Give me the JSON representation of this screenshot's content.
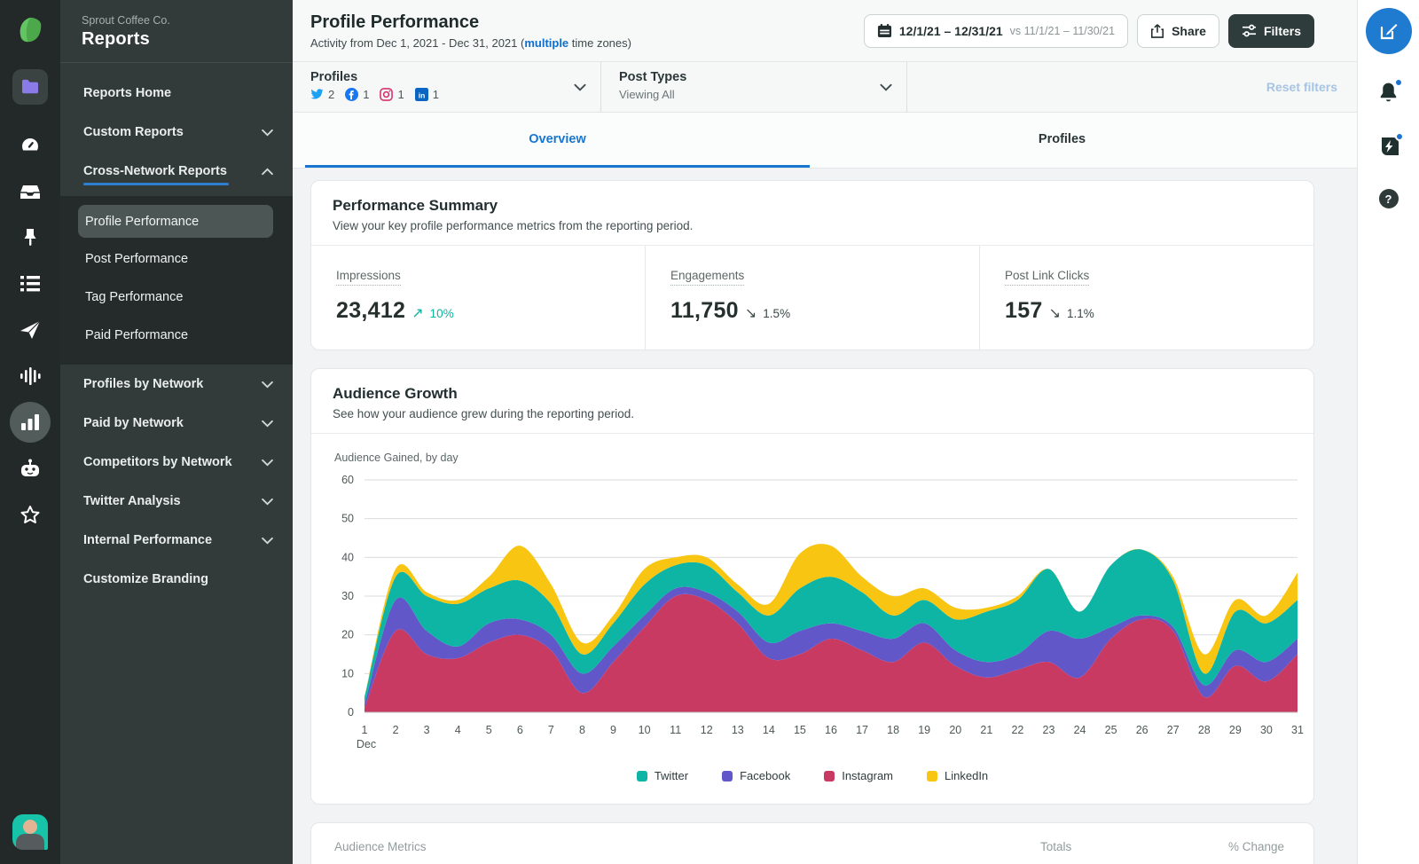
{
  "sidebar": {
    "company": "Sprout Coffee Co.",
    "title": "Reports",
    "items": [
      {
        "label": "Reports Home",
        "chevron": null,
        "active": false
      },
      {
        "label": "Custom Reports",
        "chevron": "down",
        "active": false
      },
      {
        "label": "Cross-Network Reports",
        "chevron": "up",
        "active": true,
        "children": [
          "Profile Performance",
          "Post Performance",
          "Tag Performance",
          "Paid Performance"
        ],
        "selected_child": "Profile Performance"
      },
      {
        "label": "Profiles by Network",
        "chevron": "down",
        "active": false
      },
      {
        "label": "Paid by Network",
        "chevron": "down",
        "active": false
      },
      {
        "label": "Competitors by Network",
        "chevron": "down",
        "active": false
      },
      {
        "label": "Twitter Analysis",
        "chevron": "down",
        "active": false
      },
      {
        "label": "Internal Performance",
        "chevron": "down",
        "active": false
      },
      {
        "label": "Customize Branding",
        "chevron": null,
        "active": false
      }
    ]
  },
  "header": {
    "title": "Profile Performance",
    "subtitle_prefix": "Activity from Dec 1, 2021 - Dec 31, 2021 (",
    "subtitle_link": "multiple",
    "subtitle_suffix": " time zones)",
    "date_range": "12/1/21 – 12/31/21",
    "date_compare": "vs 11/1/21 – 11/30/21",
    "share_label": "Share",
    "filters_label": "Filters"
  },
  "filter_bar": {
    "profiles_label": "Profiles",
    "profiles": [
      {
        "network": "twitter",
        "count": "2"
      },
      {
        "network": "facebook",
        "count": "1"
      },
      {
        "network": "instagram",
        "count": "1"
      },
      {
        "network": "linkedin",
        "count": "1"
      }
    ],
    "post_types_label": "Post Types",
    "post_types_value": "Viewing All",
    "reset_label": "Reset filters"
  },
  "tabs": [
    {
      "label": "Overview",
      "active": true
    },
    {
      "label": "Profiles",
      "active": false
    }
  ],
  "summary_card": {
    "title": "Performance Summary",
    "subtitle": "View your key profile performance metrics from the reporting period.",
    "up_glyph": "↗",
    "down_glyph": "↘",
    "metrics": [
      {
        "label": "Impressions",
        "value": "23,412",
        "trend": "up",
        "change": "10%"
      },
      {
        "label": "Engagements",
        "value": "11,750",
        "trend": "down",
        "change": "1.5%"
      },
      {
        "label": "Post Link Clicks",
        "value": "157",
        "trend": "down",
        "change": "1.1%"
      }
    ]
  },
  "growth_card": {
    "title": "Audience Growth",
    "subtitle": "See how your audience grew during the reporting period.",
    "chart_label": "Audience Gained, by day"
  },
  "chart_data": {
    "type": "area",
    "stacked": true,
    "title": "Audience Gained, by day",
    "x": [
      1,
      2,
      3,
      4,
      5,
      6,
      7,
      8,
      9,
      10,
      11,
      12,
      13,
      14,
      15,
      16,
      17,
      18,
      19,
      20,
      21,
      22,
      23,
      24,
      25,
      26,
      27,
      28,
      29,
      30,
      31
    ],
    "x_unit_label": "Dec",
    "ylim": [
      0,
      60
    ],
    "yticks": [
      0,
      10,
      20,
      30,
      40,
      50,
      60
    ],
    "grid": true,
    "legend_position": "bottom",
    "series": [
      {
        "name": "Instagram",
        "color": "#C93A63",
        "values": [
          1,
          21,
          15,
          14,
          18,
          20,
          16,
          5,
          13,
          22,
          30,
          29,
          23,
          14,
          15,
          19,
          16,
          13,
          18,
          12,
          9,
          11,
          13,
          9,
          19,
          24,
          21,
          4,
          12,
          8,
          15
        ]
      },
      {
        "name": "Facebook",
        "color": "#6257C8",
        "values": [
          1,
          8,
          6,
          3,
          5,
          4,
          4,
          5,
          4,
          3,
          2,
          2,
          3,
          4,
          6,
          4,
          5,
          6,
          5,
          4,
          4,
          4,
          8,
          10,
          3,
          1,
          1,
          3,
          4,
          5,
          4
        ]
      },
      {
        "name": "Twitter",
        "color": "#0EB5A5",
        "values": [
          2,
          6,
          9,
          11,
          9,
          10,
          8,
          5,
          6,
          8,
          6,
          7,
          5,
          7,
          11,
          12,
          10,
          6,
          6,
          8,
          13,
          14,
          16,
          7,
          16,
          17,
          12,
          3,
          10,
          10,
          10
        ]
      },
      {
        "name": "LinkedIn",
        "color": "#F9C513",
        "values": [
          0,
          2,
          1,
          1,
          3,
          9,
          5,
          3,
          2,
          4,
          2,
          2,
          2,
          3,
          9,
          8,
          4,
          5,
          3,
          3,
          1,
          1,
          0,
          0,
          0,
          0,
          1,
          5,
          3,
          2,
          7
        ]
      }
    ],
    "legend_order": [
      "Twitter",
      "Facebook",
      "Instagram",
      "LinkedIn"
    ]
  },
  "metrics_table": {
    "header": "Audience Metrics",
    "totals_label": "Totals",
    "change_label": "% Change"
  },
  "icons": {
    "trend_up": "↗",
    "trend_down": "↘",
    "help_glyph": "?",
    "network_colors": {
      "twitter": "#1DA1F2",
      "facebook": "#1877F2",
      "instagram": "#D6356F",
      "linkedin": "#0A66C2"
    }
  }
}
